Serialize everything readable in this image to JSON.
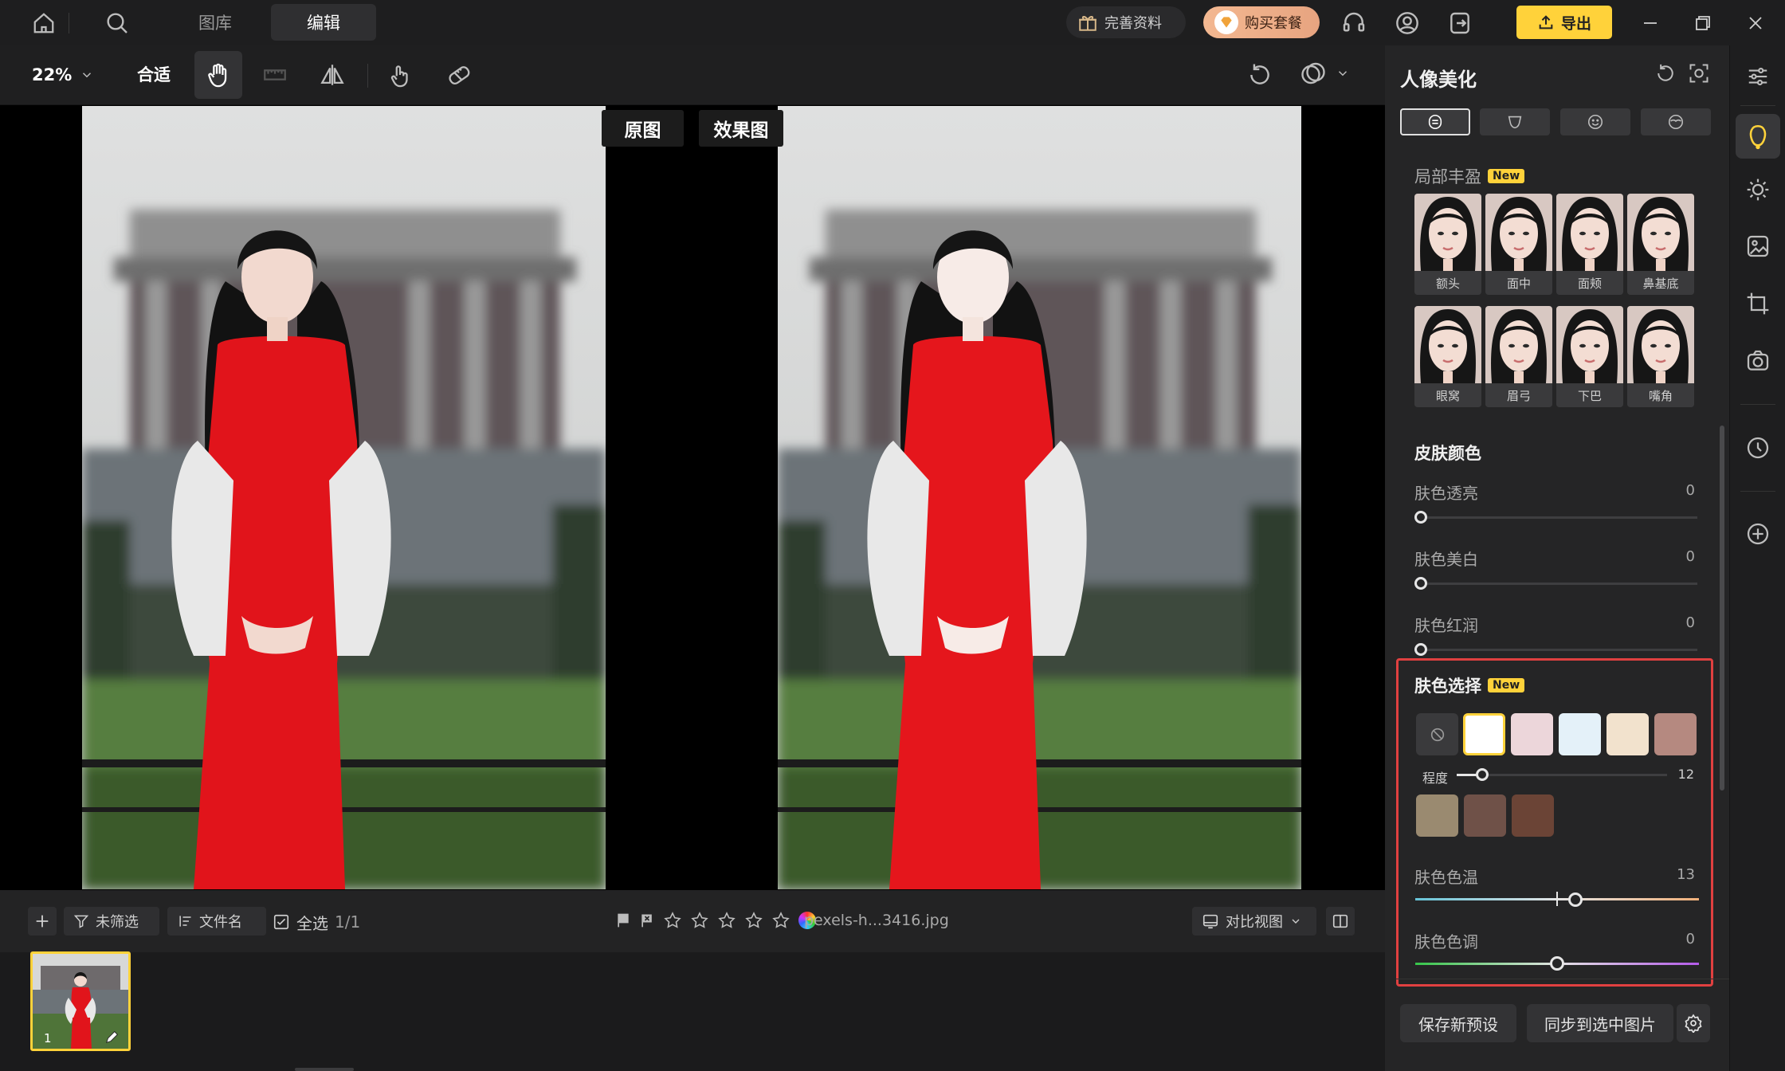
{
  "titlebar": {
    "tabs": [
      {
        "label": "图库"
      },
      {
        "label": "编辑"
      }
    ],
    "complete_profile": "完善资料",
    "buy_package": "购买套餐",
    "export": "导出"
  },
  "toolbar": {
    "zoom": "22%",
    "fit": "合适"
  },
  "canvas": {
    "original_label": "原图",
    "effect_label": "效果图"
  },
  "bottombar": {
    "filter": "未筛选",
    "sort": "文件名",
    "select_all": "全选",
    "count": "1/1",
    "filename": "pexels-h...3416.jpg",
    "compare_view": "对比视图",
    "rating_stars": 0
  },
  "filmstrip": {
    "index": "1"
  },
  "panel": {
    "title": "人像美化",
    "local_fill": {
      "title": "局部丰盈",
      "badge": "New",
      "items": [
        {
          "label": "额头"
        },
        {
          "label": "面中"
        },
        {
          "label": "面颊"
        },
        {
          "label": "鼻基底"
        },
        {
          "label": "眼窝"
        },
        {
          "label": "眉弓"
        },
        {
          "label": "下巴"
        },
        {
          "label": "嘴角"
        }
      ]
    },
    "skin_color": {
      "title": "皮肤颜色",
      "sliders": [
        {
          "label": "肤色透亮",
          "value": "0"
        },
        {
          "label": "肤色美白",
          "value": "0"
        },
        {
          "label": "肤色红润",
          "value": "0"
        }
      ]
    },
    "skin_select": {
      "title": "肤色选择",
      "badge": "New",
      "swatch_colors": [
        "#ffffff",
        "#ecd6da",
        "#e4f1f9",
        "#f2e2cd",
        "#b58980"
      ],
      "swatch_colors_dark": [
        "#9a8a70",
        "#6f5148",
        "#6b4436"
      ],
      "degree_label": "程度",
      "degree_value": "12",
      "degree_fraction": 0.12
    },
    "temperature": {
      "label": "肤色色温",
      "value": "13",
      "fraction": 0.565
    },
    "tint": {
      "label": "肤色色调",
      "value": "0",
      "fraction": 0.5
    },
    "save_preset": "保存新预设",
    "sync": "同步到选中图片"
  },
  "colors": {
    "accent_yellow": "#ffd23a",
    "highlight_red": "#e04040"
  }
}
